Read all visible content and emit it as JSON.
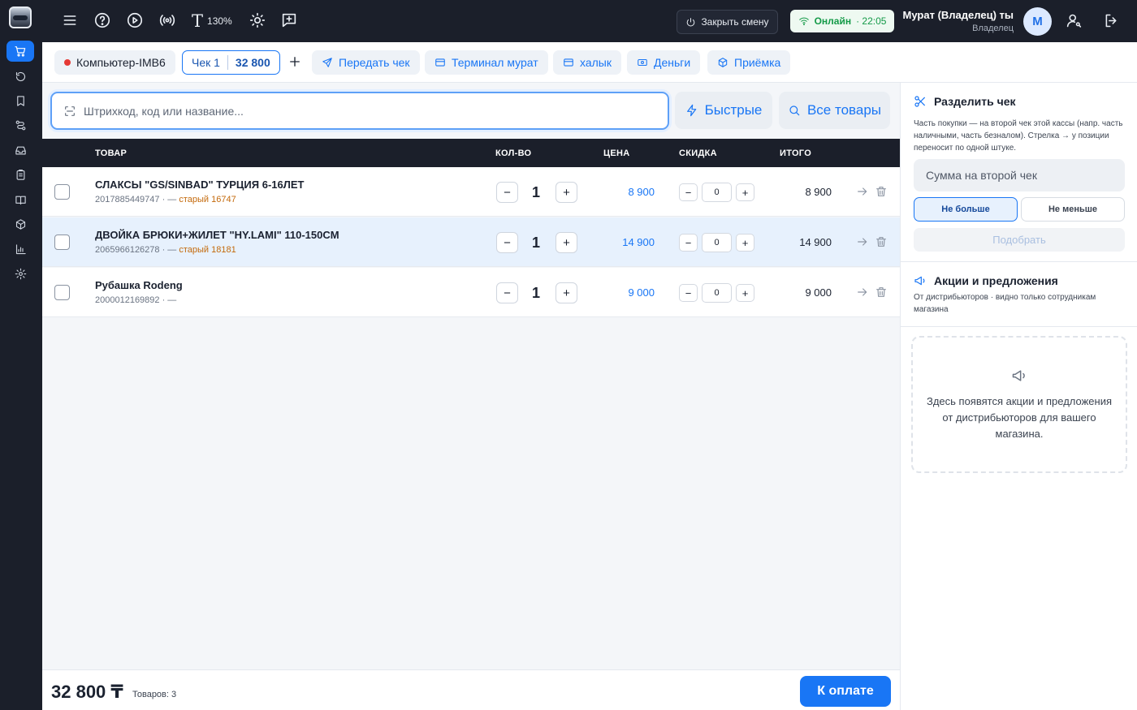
{
  "topbar": {
    "zoom_label": "130%",
    "close_shift_label": "Закрыть смену",
    "status_label": "Онлайн",
    "status_time": "· 22:05",
    "user_name": "Мурат (Владелец) ты",
    "user_role": "Владелец",
    "avatar_letter": "М"
  },
  "tabs": {
    "computer_label": "Компьютер-IMB6",
    "check_label": "Чек 1",
    "check_sum": "32 800",
    "actions": [
      "Передать чек",
      "Терминал мурат",
      "халык",
      "Деньги",
      "Приёмка"
    ]
  },
  "search": {
    "placeholder": "Штрихкод, код или название...",
    "quick_label": "Быстрые",
    "all_label": "Все товары"
  },
  "table": {
    "headers": {
      "product": "ТОВАР",
      "qty": "КОЛ-ВО",
      "price": "ЦЕНА",
      "discount": "СКИДКА",
      "total": "ИТОГО"
    },
    "rows": [
      {
        "name": "СЛАКСЫ \"GS/SINBAD\" ТУРЦИЯ 6-16ЛЕТ",
        "code": "2017885449747 · —",
        "old_price": "старый 16747",
        "qty": "1",
        "price": "8 900",
        "discount": "0",
        "total": "8 900"
      },
      {
        "name": "ДВОЙКА БРЮКИ+ЖИЛЕТ \"HY.LAMI\" 110-150CM",
        "code": "2065966126278 · —",
        "old_price": "старый 18181",
        "qty": "1",
        "price": "14 900",
        "discount": "0",
        "total": "14 900"
      },
      {
        "name": "Рубашка Rodeng",
        "code": "2000012169892 · —",
        "old_price": "",
        "qty": "1",
        "price": "9 000",
        "discount": "0",
        "total": "9 000"
      }
    ]
  },
  "footer": {
    "grand_total": "32 800 ₸",
    "items_count": "Товаров: 3",
    "pay_label": "К оплате"
  },
  "split": {
    "title": "Разделить чек",
    "hint": "Часть покупки — на второй чек этой кассы (напр. часть наличными, часть безналом). Стрелка → у позиции переносит по одной штуке.",
    "sum_placeholder": "Сумма на второй чек",
    "option_max": "Не больше",
    "option_min": "Не меньше",
    "pick_label": "Подобрать"
  },
  "promos": {
    "title": "Акции и предложения",
    "subtitle": "От дистрибьюторов · видно только сотрудникам магазина",
    "empty_text": "Здесь появятся акции и предложения от дистрибьюторов для вашего магазина."
  }
}
